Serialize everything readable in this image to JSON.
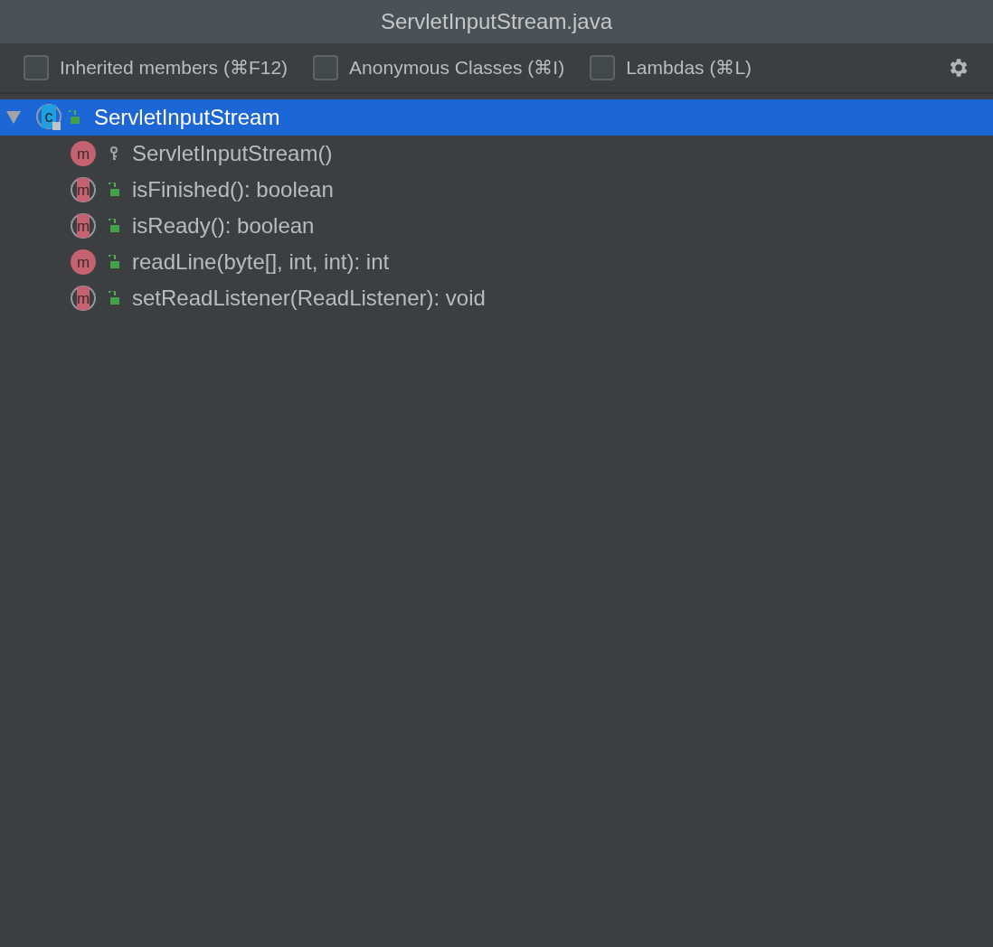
{
  "window": {
    "title": "ServletInputStream.java"
  },
  "options": [
    {
      "label": "Inherited members (⌘F12)",
      "checked": false
    },
    {
      "label": "Anonymous Classes (⌘I)",
      "checked": false
    },
    {
      "label": "Lambdas (⌘L)",
      "checked": false
    }
  ],
  "tree": {
    "label": "ServletInputStream",
    "icon": "c",
    "public": true,
    "expanded": true,
    "selected": true,
    "children": [
      {
        "label": "ServletInputStream()",
        "icon": "m",
        "abstract": false,
        "public": false,
        "selected": false
      },
      {
        "label": "isFinished(): boolean",
        "icon": "m",
        "abstract": true,
        "public": true,
        "selected": false
      },
      {
        "label": "isReady(): boolean",
        "icon": "m",
        "abstract": true,
        "public": true,
        "selected": false
      },
      {
        "label": "readLine(byte[], int, int): int",
        "icon": "m",
        "abstract": false,
        "public": true,
        "selected": false
      },
      {
        "label": "setReadListener(ReadListener): void",
        "icon": "m",
        "abstract": true,
        "public": true,
        "selected": false
      }
    ]
  }
}
